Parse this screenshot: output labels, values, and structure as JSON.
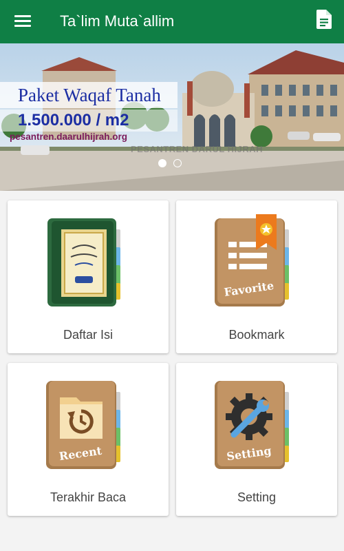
{
  "app": {
    "title": "Ta`lim Muta`allim",
    "primary_color": "#0f7f45"
  },
  "banner": {
    "title": "Paket Waqaf Tanah",
    "price": "1.500.000 / m2",
    "url": "pesantren.daarulhijrah.org",
    "watermark": "PESANTREN DARUL HIJRAH",
    "active_slide": 1,
    "slide_count": 2
  },
  "menu": [
    {
      "label": "Daftar Isi",
      "icon": "book-cover-icon"
    },
    {
      "label": "Bookmark",
      "icon": "favorite-book-icon",
      "icon_text": "Favorite"
    },
    {
      "label": "Terakhir Baca",
      "icon": "recent-book-icon",
      "icon_text": "Recent"
    },
    {
      "label": "Setting",
      "icon": "setting-book-icon",
      "icon_text": "Setting"
    }
  ]
}
